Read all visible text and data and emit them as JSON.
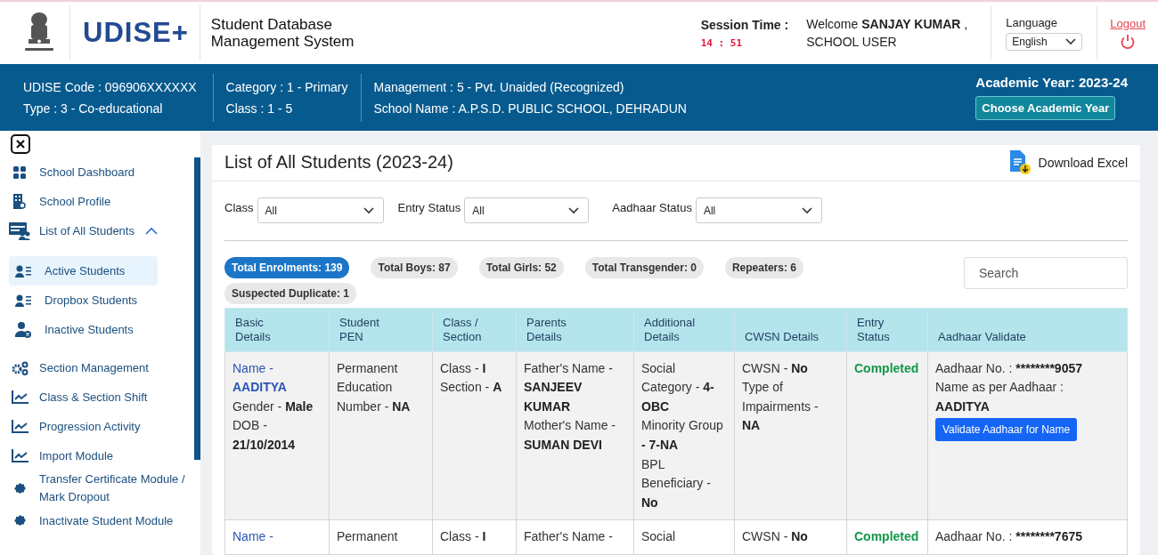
{
  "header": {
    "logo_text": "UDISE+",
    "title_lines": [
      "Student Database",
      "Management System"
    ],
    "session_label": "Session Time :",
    "session_time": "14 : 51",
    "welcome": "Welcome **SANJAY KUMAR** ,\nSCHOOL USER",
    "language_label": "Language",
    "language": "English",
    "logout": "Logout"
  },
  "school_info": {
    "columns": [
      [
        "UDISE Code : 096906XXXXXX",
        "Type : 3 - Co-educational"
      ],
      [
        "Category : 1 - Primary",
        "Class : 1 - 5"
      ],
      [
        "Management : 5 - Pvt. Unaided (Recognized)",
        "School Name : A.P.S.D. PUBLIC SCHOOL, DEHRADUN"
      ]
    ],
    "academic_year": "Academic Year: 2023-24",
    "choose_button": "Choose Academic Year"
  },
  "sidebar": {
    "items": [
      {
        "label": "School Dashboard"
      },
      {
        "label": "School Profile"
      },
      {
        "label": "List of All Students",
        "expanded": true,
        "children": [
          {
            "label": "Active Students",
            "selected": true
          },
          {
            "label": "Dropbox Students",
            "selected": false
          },
          {
            "label": "Inactive Students",
            "selected": false
          }
        ]
      },
      {
        "label": "Section Management"
      },
      {
        "label": "Class & Section Shift"
      },
      {
        "label": "Progression Activity"
      },
      {
        "label": "Import Module"
      },
      {
        "label": "Transfer Certificate Module / Mark Dropout"
      },
      {
        "label": "Inactivate Student Module"
      }
    ]
  },
  "panel": {
    "title": "List of All Students (2023-24)",
    "download": "Download Excel",
    "filters": [
      {
        "label": "Class",
        "value": "All"
      },
      {
        "label": "Entry Status",
        "value": "All"
      },
      {
        "label": "Aadhaar Status",
        "value": "All"
      }
    ],
    "chips": [
      {
        "label": "Total Enrolments: 139",
        "selected": true
      },
      {
        "label": "Total Boys: 87",
        "selected": false
      },
      {
        "label": "Total Girls: 52",
        "selected": false
      },
      {
        "label": "Total Transgender: 0",
        "selected": false
      },
      {
        "label": "Repeaters: 6",
        "selected": false
      },
      {
        "label": "Suspected Duplicate: 1",
        "selected": false
      }
    ],
    "search": {
      "placeholder": "Search"
    },
    "table": {
      "columns": [
        "Basic\nDetails",
        "Student\nPEN",
        "Class /\nSection",
        "Parents\nDetails",
        "Additional\nDetails",
        "CWSN Details",
        "Entry\nStatus",
        "Aadhaar Validate"
      ],
      "rows": [
        {
          "cells": [
            {
              "kind": "basic",
              "name": "Name -\n**AADITYA**",
              "text": "Gender - **Male**\nDOB -\n**21/10/2014**"
            },
            {
              "kind": "text",
              "text": "Permanent\nEducation\nNumber - **NA**"
            },
            {
              "kind": "text",
              "text": "Class - **I**\nSection - **A**"
            },
            {
              "kind": "text",
              "text": "Father's Name -\n**SANJEEV**\n**KUMAR**\nMother's Name -\n**SUMAN DEVI**"
            },
            {
              "kind": "text",
              "text": "Social\nCategory - **4-**\n**OBC**\nMinority Group\n**- 7-NA**\nBPL\nBeneficiary -\n**No**"
            },
            {
              "kind": "text",
              "text": "CWSN - **No**\nType of\nImpairments -\n**NA**"
            },
            {
              "kind": "status",
              "text": "Completed"
            },
            {
              "kind": "aadhaar",
              "label": "Aadhaar No. :",
              "number": "********9057",
              "name_label": "Name as per Aadhaar :",
              "name": "AADITYA",
              "button": "Validate Aadhaar for Name"
            }
          ]
        },
        {
          "cells": [
            {
              "kind": "basic",
              "name": "Name -"
            },
            {
              "kind": "text",
              "text": "Permanent"
            },
            {
              "kind": "text",
              "text": "Class - **I**"
            },
            {
              "kind": "text",
              "text": "Father's Name -"
            },
            {
              "kind": "text",
              "text": "Social"
            },
            {
              "kind": "text",
              "text": "CWSN - **No**"
            },
            {
              "kind": "status",
              "text": "Completed"
            },
            {
              "kind": "aadhaar",
              "label": "Aadhaar No. :",
              "number": "********7675"
            }
          ]
        }
      ]
    }
  }
}
